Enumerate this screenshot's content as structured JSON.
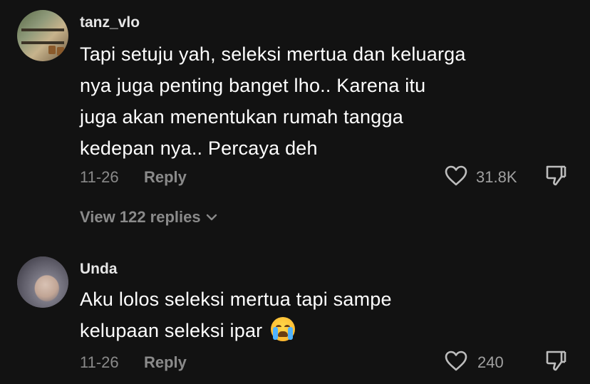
{
  "comments": [
    {
      "username": "tanz_vlo",
      "lines": [
        "Tapi setuju yah, seleksi mertua dan keluarga",
        "nya juga penting banget lho.. Karena itu",
        "juga akan menentukan rumah tangga",
        "kedepan nya.. Percaya deh"
      ],
      "date": "11-26",
      "reply_label": "Reply",
      "likes": "31.8K",
      "view_replies": "View 122 replies"
    },
    {
      "username": "Unda",
      "lines": [
        "Aku lolos seleksi mertua tapi sampe",
        "kelupaan seleksi ipar"
      ],
      "emoji": "loudly-crying-face",
      "date": "11-26",
      "reply_label": "Reply",
      "likes": "240"
    }
  ],
  "colors": {
    "background": "#121212",
    "text": "#ffffff",
    "muted": "#8a8a8a"
  }
}
